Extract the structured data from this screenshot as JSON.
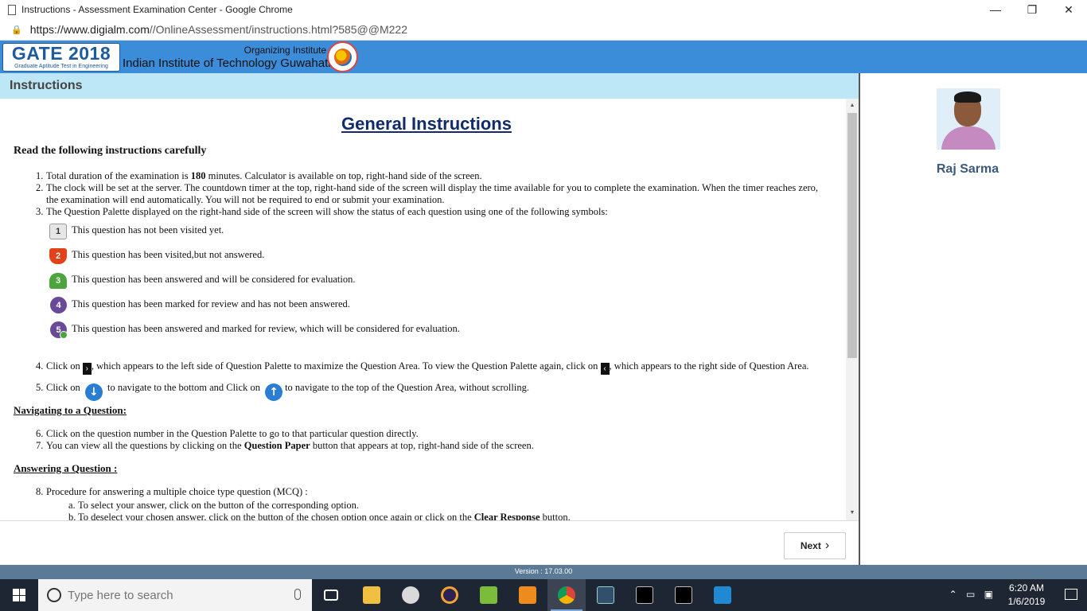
{
  "window": {
    "title": "Instructions - Assessment Examination Center - Google Chrome",
    "minimize": "—",
    "restore": "❐",
    "close": "✕"
  },
  "address": {
    "url_host": "https://www.digialm.com",
    "url_path": "//OnlineAssessment/instructions.html?585@@M222"
  },
  "header": {
    "logo_main": "GATE 2018",
    "logo_sub": "Graduate Aptitude Test in Engineering",
    "organizing_label": "Organizing Institute",
    "institute": "Indian Institute of Technology Guwahati"
  },
  "instructions_bar": "Instructions",
  "content": {
    "heading": "General Instructions",
    "read_carefully": "Read the following instructions carefully",
    "item1_pre": "Total duration of the examination is ",
    "item1_bold": "180",
    "item1_post": " minutes. Calculator is available on top, right-hand side of the screen.",
    "item2_line1": "The clock will be set at the server. The countdown timer at the top, right-hand side of the screen will display the time available for you to complete the examination. When the timer reaches zero,",
    "item2_line2": "the examination will end automatically. You will not be required to end or submit your examination.",
    "item3": "The Question Palette displayed on the right-hand side of the screen will show the status of each question using one of the following symbols:",
    "symbols": [
      {
        "num": "1",
        "text": "This question has not been visited yet."
      },
      {
        "num": "2",
        "text": "This question has been visited,but not answered."
      },
      {
        "num": "3",
        "text": "This question has been answered and will be considered for evaluation."
      },
      {
        "num": "4",
        "text": "This question has been marked for review and has not been answered."
      },
      {
        "num": "5",
        "text": "This question has been answered and marked for review, which will be considered for evaluation."
      }
    ],
    "item4_pre": "Click on ",
    "item4_mid": ", which appears to the left side of Question Palette to maximize the Question Area. To view the Question Palette again, click on ",
    "item4_post": ", which appears to the right side of Question Area.",
    "item5_pre": "Click on ",
    "item5_mid": " to navigate to the bottom and Click on ",
    "item5_post": "to navigate to the top of the Question Area, without scrolling.",
    "nav_heading": "Navigating to a Question:",
    "item6": "Click on the question number in the Question Palette to go to that particular question directly.",
    "item7_pre": "You can view all the questions by clicking on the ",
    "item7_bold": "Question Paper",
    "item7_post": " button that appears at top, right-hand side of the screen.",
    "answer_heading": "Answering a Question :",
    "item8": "Procedure for answering a multiple choice type question (MCQ) :",
    "item8a": "To select your answer, click on the button of the corresponding option.",
    "item8b_pre": "To deselect your chosen answer, click on the button of the chosen option once again or click on the ",
    "item8b_bold": "Clear Response",
    "item8b_post": " button.",
    "numbers": [
      "1.",
      "2.",
      "3.",
      "4.",
      "5.",
      "6.",
      "7.",
      "8.",
      "a.",
      "b."
    ]
  },
  "next_button": "Next",
  "user": {
    "name": "Raj Sarma"
  },
  "version": "Version : 17.03.00",
  "taskbar": {
    "search_placeholder": "Type here to search",
    "time": "6:20 AM",
    "date": "1/6/2019"
  }
}
